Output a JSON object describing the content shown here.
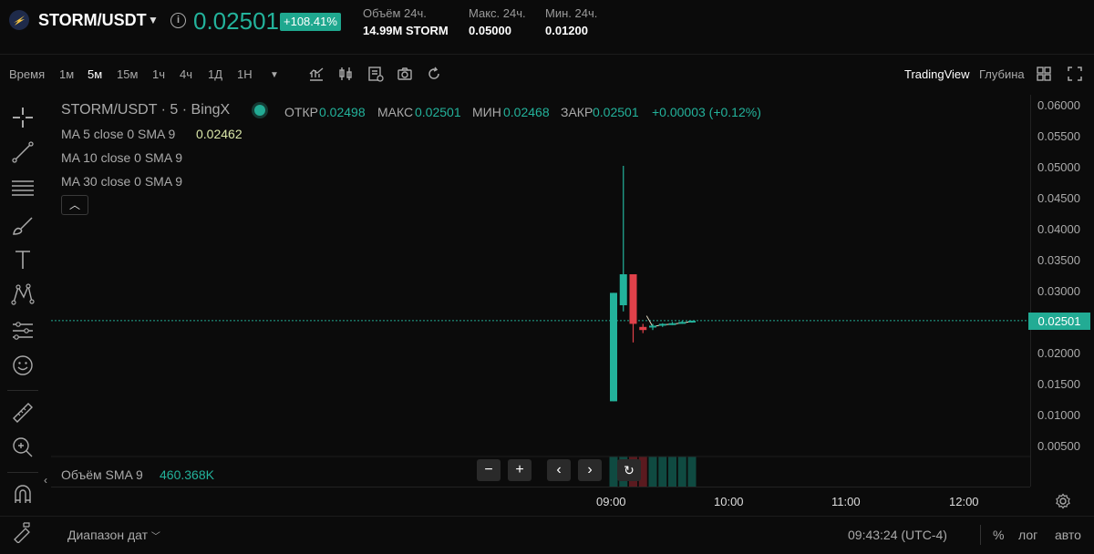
{
  "header": {
    "symbol": "STORM/USDT",
    "price": "0.02501",
    "change": "+108.41%",
    "stats": [
      {
        "label": "Объём 24ч.",
        "value": "14.99M STORM"
      },
      {
        "label": "Макс. 24ч.",
        "value": "0.05000"
      },
      {
        "label": "Мин. 24ч.",
        "value": "0.01200"
      }
    ]
  },
  "toolbar": {
    "time_label": "Время",
    "intervals": [
      "1м",
      "5м",
      "15м",
      "1ч",
      "4ч",
      "1Д",
      "1Н"
    ],
    "active_interval": "5м",
    "view_tradingview": "TradingView",
    "view_depth": "Глубина"
  },
  "legend": {
    "title": "STORM/USDT · 5 · BingX",
    "ohlc": [
      {
        "label": "ОТКР",
        "value": "0.02498"
      },
      {
        "label": "МАКС",
        "value": "0.02501"
      },
      {
        "label": "МИН",
        "value": "0.02468"
      },
      {
        "label": "ЗАКР",
        "value": "0.02501"
      }
    ],
    "change": "+0.00003 (+0.12%)",
    "ma": [
      {
        "label": "MA 5 close 0 SMA 9",
        "value": "0.02462"
      },
      {
        "label": "MA 10 close 0 SMA 9",
        "value": ""
      },
      {
        "label": "MA 30 close 0 SMA 9",
        "value": ""
      }
    ]
  },
  "price_axis": {
    "ticks": [
      "0.06000",
      "0.05500",
      "0.05000",
      "0.04500",
      "0.04000",
      "0.03500",
      "0.03000",
      "0.02000",
      "0.01500",
      "0.01000",
      "0.00500"
    ],
    "current": "0.02501"
  },
  "volume": {
    "label": "Объём SMA 9",
    "value": "460.368K"
  },
  "time_axis": {
    "ticks": [
      "09:00",
      "10:00",
      "11:00",
      "12:00"
    ]
  },
  "bottom": {
    "range_label": "Диапазон дат",
    "clock": "09:43:24 (UTC-4)",
    "opt_percent": "%",
    "opt_log": "лог",
    "opt_auto": "авто"
  },
  "colors": {
    "up": "#23b29b",
    "down": "#e0414a",
    "accent": "#22ab94"
  },
  "chart_data": {
    "type": "candlestick",
    "x_unit": "time",
    "candles": [
      {
        "time": "09:00",
        "open": 0.012,
        "high": 0.0295,
        "low": 0.012,
        "close": 0.0295
      },
      {
        "time": "09:05",
        "open": 0.0275,
        "high": 0.05,
        "low": 0.0265,
        "close": 0.0325
      },
      {
        "time": "09:10",
        "open": 0.0325,
        "high": 0.0325,
        "low": 0.0215,
        "close": 0.0245
      },
      {
        "time": "09:15",
        "open": 0.024,
        "high": 0.0245,
        "low": 0.023,
        "close": 0.0235
      },
      {
        "time": "09:20",
        "open": 0.024,
        "high": 0.0245,
        "low": 0.0235,
        "close": 0.0242
      },
      {
        "time": "09:25",
        "open": 0.0243,
        "high": 0.0246,
        "low": 0.024,
        "close": 0.0245
      },
      {
        "time": "09:30",
        "open": 0.0245,
        "high": 0.0248,
        "low": 0.0243,
        "close": 0.0246
      },
      {
        "time": "09:35",
        "open": 0.0246,
        "high": 0.025,
        "low": 0.0245,
        "close": 0.0248
      },
      {
        "time": "09:40",
        "open": 0.02498,
        "high": 0.02501,
        "low": 0.02468,
        "close": 0.02501
      }
    ],
    "ylim": [
      0.0025,
      0.0625
    ],
    "xlim": [
      "08:55",
      "13:00"
    ]
  }
}
